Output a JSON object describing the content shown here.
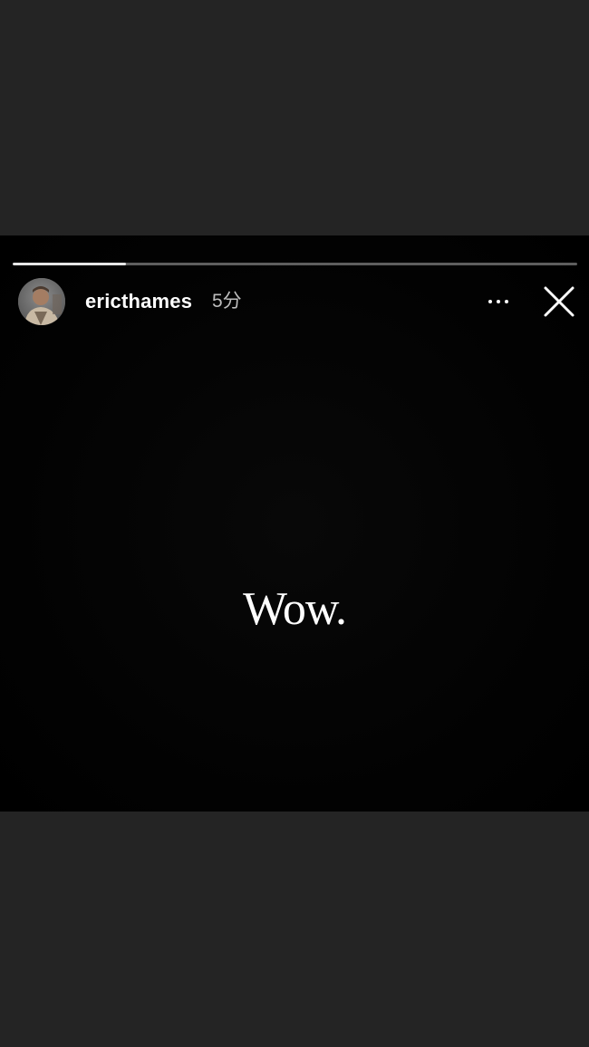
{
  "story": {
    "progress": {
      "fraction_viewed": 0.2
    },
    "author": {
      "username": "ericthames",
      "time_ago": "5分",
      "avatar_icon": "profile-photo"
    },
    "controls": {
      "more_icon": "more-horizontal-icon",
      "close_icon": "close-icon"
    },
    "content": {
      "text": "Wow."
    }
  }
}
